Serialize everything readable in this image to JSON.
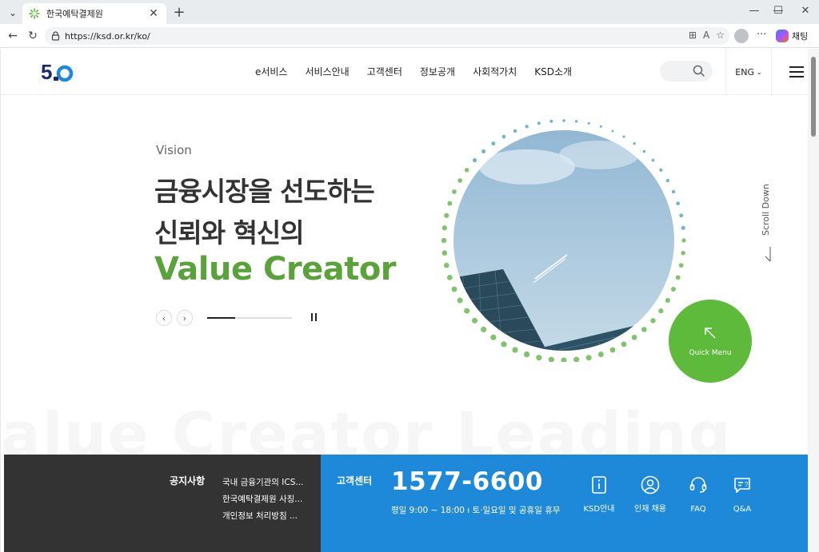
{
  "browser": {
    "tab_title": "한국예탁결제원",
    "tab_close": "✕",
    "new_tab": "+",
    "url": "https://ksd.or.kr/ko/",
    "chat_label": "채팅",
    "minimize": "—",
    "maximize": "☐",
    "close": "✕"
  },
  "header": {
    "logo_text": "50",
    "nav": [
      "e서비스",
      "서비스안내",
      "고객센터",
      "정보공개",
      "사회적가치",
      "KSD소개"
    ],
    "lang": "ENG"
  },
  "hero": {
    "eyebrow": "Vision",
    "line1": "금융시장을 선도하는",
    "line2": "신뢰와 혁신의",
    "highlight": "Value Creator",
    "prev_label": "‹",
    "next_label": "›",
    "progress": 0.33,
    "watermark": "alue Creator Leading"
  },
  "side": {
    "scroll_down": "Scroll Down",
    "quick_menu": "Quick Menu"
  },
  "notice": {
    "title": "공지사항",
    "items": [
      "국내 금융기관의 ICS...",
      "한국예탁결제원 사칭...",
      "개인정보 처리방침 ..."
    ]
  },
  "customer_center": {
    "title": "고객센터",
    "phone": "1577-6600",
    "hours": "평일 9:00 ~ 18:00 ı 토·일요일 및 공휴일 휴무",
    "links": [
      "KSD안내",
      "인재 채용",
      "FAQ",
      "Q&A"
    ]
  },
  "colors": {
    "brand_green": "#5aa33a",
    "quick_menu_green": "#5dba3b",
    "cs_blue": "#1e88d9",
    "notice_dark": "#333333"
  }
}
